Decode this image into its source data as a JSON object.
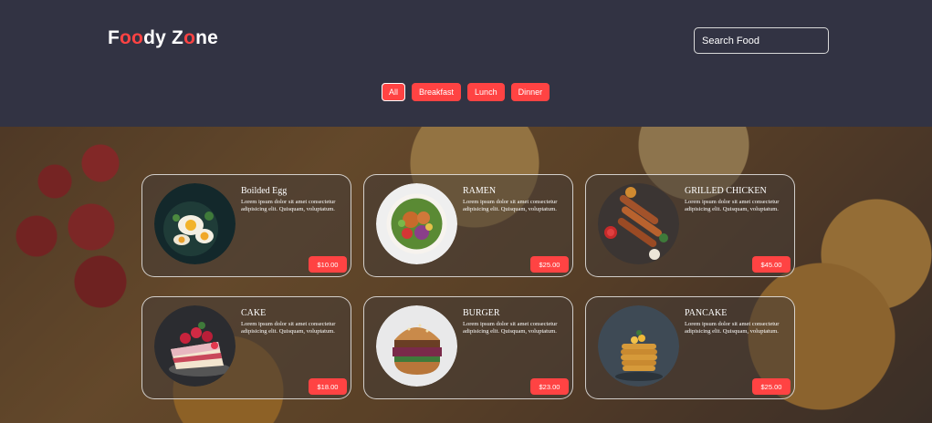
{
  "header": {
    "logo": {
      "part1": "F",
      "part2": "oo",
      "part3": "dy Z",
      "part4": "o",
      "part5": "ne"
    },
    "search": {
      "placeholder": "Search Food"
    }
  },
  "filters": [
    {
      "label": "All",
      "active": true
    },
    {
      "label": "Breakfast",
      "active": false
    },
    {
      "label": "Lunch",
      "active": false
    },
    {
      "label": "Dinner",
      "active": false
    }
  ],
  "foods": [
    {
      "name": "Boilded Egg",
      "text": "Lorem ipsum dolor sit amet consectetur adipisicing elit. Quisquam, voluptatum.",
      "price": "$10.00",
      "image": "boiled-egg-image"
    },
    {
      "name": "RAMEN",
      "text": "Lorem ipsum dolor sit amet consectetur adipisicing elit. Quisquam, voluptatum.",
      "price": "$25.00",
      "image": "ramen-image"
    },
    {
      "name": "GRILLED CHICKEN",
      "text": "Lorem ipsum dolor sit amet consectetur adipisicing elit. Quisquam, voluptatum.",
      "price": "$45.00",
      "image": "grilled-chicken-image"
    },
    {
      "name": "CAKE",
      "text": "Lorem ipsum dolor sit amet consectetur adipisicing elit. Quisquam, voluptatum.",
      "price": "$18.00",
      "image": "cake-image"
    },
    {
      "name": "BURGER",
      "text": "Lorem ipsum dolor sit amet consectetur adipisicing elit. Quisquam, voluptatum.",
      "price": "$23.00",
      "image": "burger-image"
    },
    {
      "name": "PANCAKE",
      "text": "Lorem ipsum dolor sit amet consectetur adipisicing elit. Quisquam, voluptatum.",
      "price": "$25.00",
      "image": "pancake-image"
    }
  ],
  "colors": {
    "header_bg": "#323343",
    "accent": "#ff4343",
    "text": "#ffffff"
  }
}
